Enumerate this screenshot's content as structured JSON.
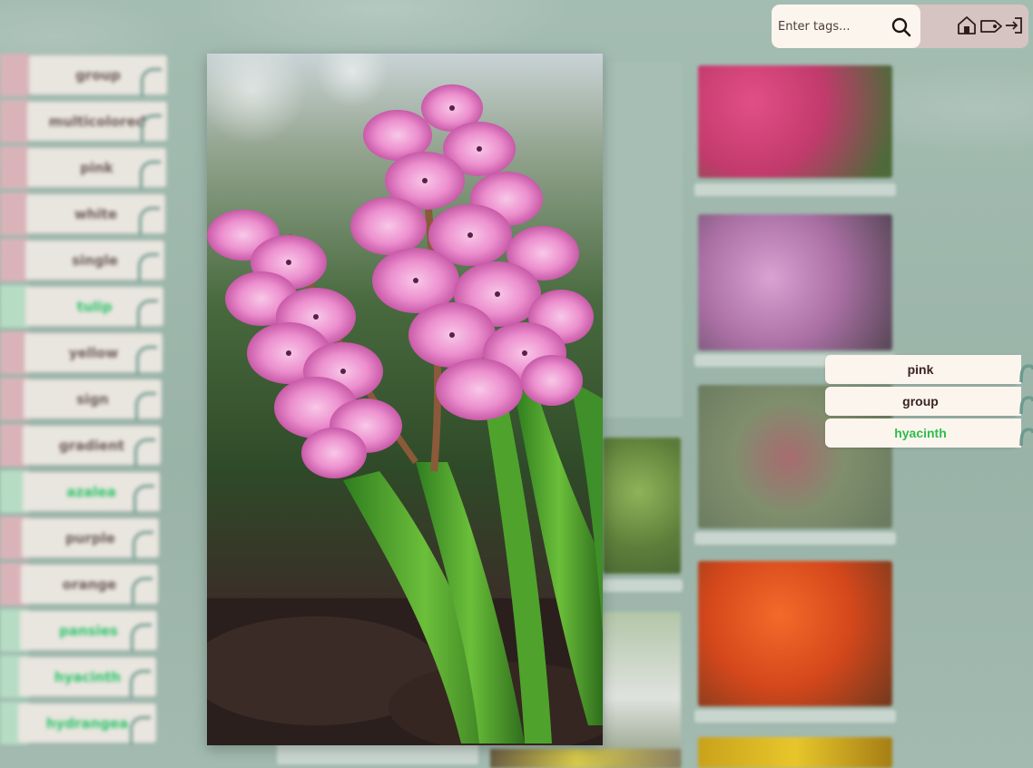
{
  "search": {
    "placeholder": "Enter tags..."
  },
  "nav": {
    "home": "home-icon",
    "tag": "tag-icon",
    "login": "login-icon"
  },
  "tag_list": [
    {
      "label": "group",
      "color": "#d9b3b8"
    },
    {
      "label": "multicolored",
      "color": "#d9b3b8"
    },
    {
      "label": "pink",
      "color": "#d9b3b8"
    },
    {
      "label": "white",
      "color": "#d9b3b8"
    },
    {
      "label": "single",
      "color": "#d9b3b8"
    },
    {
      "label": "tulip",
      "color": "#b6dcc4"
    },
    {
      "label": "yellow",
      "color": "#d9b3b8"
    },
    {
      "label": "sign",
      "color": "#d9b3b8"
    },
    {
      "label": "gradient",
      "color": "#d9b3b8"
    },
    {
      "label": "azalea",
      "color": "#b6dcc4"
    },
    {
      "label": "purple",
      "color": "#d9b3b8"
    },
    {
      "label": "orange",
      "color": "#d9b3b8"
    },
    {
      "label": "pansies",
      "color": "#b6dcc4"
    },
    {
      "label": "hyacinth",
      "color": "#b6dcc4"
    },
    {
      "label": "hydrangea",
      "color": "#b6dcc4"
    }
  ],
  "active_tags": [
    {
      "label": "pink",
      "highlighted": false
    },
    {
      "label": "group",
      "highlighted": false
    },
    {
      "label": "hyacinth",
      "highlighted": true
    }
  ],
  "colors": {
    "accent_green": "#2dbd4a",
    "bar_bg": "#d6c4c2",
    "input_bg": "#fbf5ee",
    "page_bg": "#9fb8ad"
  }
}
